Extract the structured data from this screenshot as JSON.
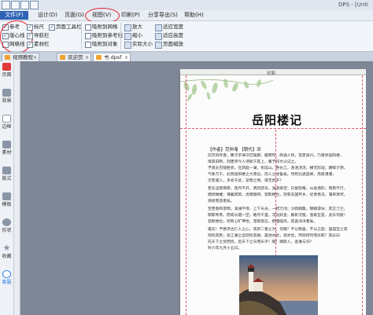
{
  "titlebar": {
    "title": "DPS - [Unti"
  },
  "menu": {
    "items": [
      {
        "label": "文件(F)"
      },
      {
        "label": "设计(D)"
      },
      {
        "label": "页面(G)"
      },
      {
        "label": "视图(V)"
      },
      {
        "label": "印刷(P)"
      },
      {
        "label": "分享导出(S)"
      },
      {
        "label": "帮助(H)"
      }
    ]
  },
  "ribbon": {
    "checks": [
      {
        "label": "参考",
        "checked": true
      },
      {
        "label": "版心线",
        "checked": true
      },
      {
        "label": "网格线",
        "checked": false
      },
      {
        "label": "标尺",
        "checked": true
      },
      {
        "label": "导航栏",
        "checked": true
      },
      {
        "label": "素材栏",
        "checked": true
      },
      {
        "label": "页面工具栏",
        "checked": true
      },
      {
        "label": "吸附到网格",
        "checked": false
      },
      {
        "label": "吸附到参考线",
        "checked": false
      },
      {
        "label": "吸附到对象",
        "checked": false
      }
    ],
    "zoom": [
      {
        "label": "放大"
      },
      {
        "label": "缩小"
      },
      {
        "label": "实际大小"
      }
    ],
    "fit": [
      {
        "label": "适应宽度"
      },
      {
        "label": "适应高度"
      },
      {
        "label": "页面缩放"
      }
    ]
  },
  "tabs": [
    {
      "label": "视频教程",
      "active": false
    },
    {
      "label": "欢迎页",
      "active": false
    },
    {
      "label": "书.dpsf",
      "active": true
    }
  ],
  "sidebar": {
    "items": [
      {
        "label": "页面",
        "icon": "page-icon",
        "color": "#e23a3a"
      },
      {
        "label": "背景",
        "icon": "background-icon",
        "color": "#8a96a8"
      },
      {
        "label": "边框",
        "icon": "border-icon",
        "color": "#8a96a8"
      },
      {
        "label": "素材",
        "icon": "material-icon",
        "color": "#8a96a8"
      },
      {
        "label": "版式",
        "icon": "layout-icon",
        "color": "#8a96a8"
      },
      {
        "label": "模板",
        "icon": "template-icon",
        "color": "#8a96a8"
      },
      {
        "label": "形状",
        "icon": "shape-icon",
        "color": "#8a96a8"
      },
      {
        "label": "收藏",
        "icon": "star-icon",
        "color": "#8a96a8"
      },
      {
        "label": "客服",
        "icon": "support-icon",
        "color": "#2c7be5"
      }
    ]
  },
  "page": {
    "header_label": "封面",
    "title": "岳阳楼记",
    "meta": "【作者】范仲淹  【朝代】宋",
    "paragraphs": [
      "庆历四年春，滕子京谪守巴陵郡。越明年，政通人和，百废具兴。乃重修岳阳楼，",
      "增其旧制，刻唐贤今人诗赋于其上，属予作文以记之。",
      "予观夫巴陵胜状，在洞庭一湖。衔远山，吞长江，浩浩汤汤，横无际涯；朝晖夕阴，",
      "气象万千。此则岳阳楼之大观也，前人之述备矣。然则北通巫峡，南极潇湘，",
      "迁客骚人，多会于此，览物之情，得无异乎？",
      "若夫淫雨霏霏，连月不开，阴风怒号，浊浪排空；日星隐曜，山岳潜形；商旅不行，",
      "樯倾楫摧；薄暮冥冥，虎啸猿啼。登斯楼也，则有去国怀乡，忧谗畏讥，满目萧然，",
      "感极而悲者矣。",
      "至若春和景明，波澜不惊，上下天光，一碧万顷；沙鸥翔集，锦鳞游泳；岸芷汀兰，",
      "郁郁青青。而或长烟一空，皓月千里，浮光跃金，静影沉璧，渔歌互答，此乐何极！",
      "登斯楼也，则有心旷神怡，宠辱偕忘，把酒临风，其喜洋洋者矣。",
      "嗟夫！予尝求古仁人之心，或异二者之为，何哉？不以物喜，不以己悲；居庙堂之高",
      "则忧其民；处江湖之远则忧其君。是进亦忧，退亦忧。然则何时而乐耶？其必曰",
      "先天下之忧而忧，后天下之乐而乐乎！噫！微斯人，吾谁与归？",
      "时六年九月十五日。"
    ]
  },
  "colors": {
    "accent": "#2f63b5",
    "highlight_ring": "#e8202a",
    "guide": "#e0576a"
  }
}
